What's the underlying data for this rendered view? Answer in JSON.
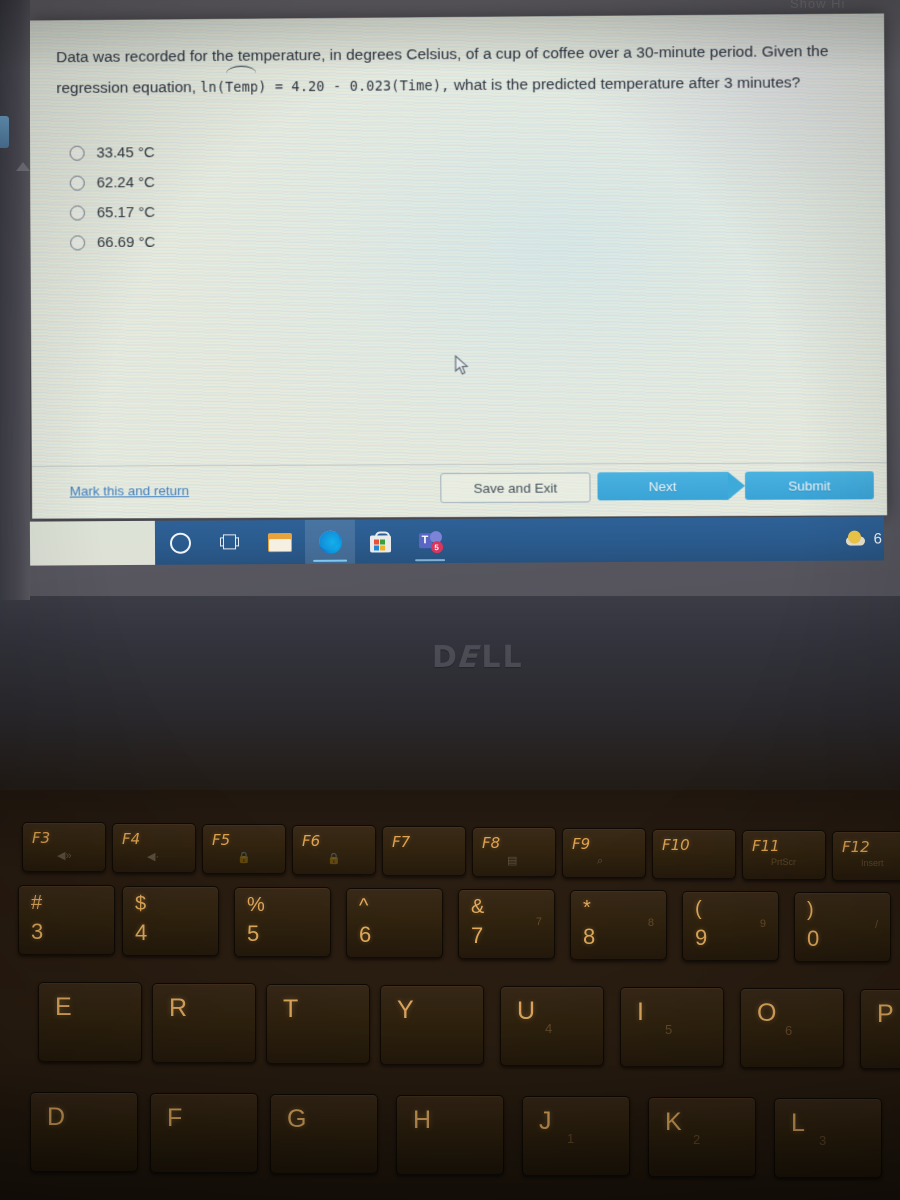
{
  "question": {
    "line1": "Data was recorded for the temperature, in degrees Celsius, of a cup of coffee over a 30-minute period. Given the",
    "line2_prefix": "regression equation, ",
    "equation_ln": "ln(",
    "equation_var": "Temp",
    "equation_rest": ") = 4.20 - 0.023(Time),",
    "line2_suffix": " what is the predicted temperature after 3 minutes?",
    "options": [
      {
        "value": "33.45",
        "unit": "°C",
        "label": "33.45 °C",
        "selected": false
      },
      {
        "value": "62.24",
        "unit": "°C",
        "label": "62.24 °C",
        "selected": false
      },
      {
        "value": "65.17",
        "unit": "°C",
        "label": "65.17 °C",
        "selected": false
      },
      {
        "value": "66.69",
        "unit": "°C",
        "label": "66.69 °C",
        "selected": false
      }
    ]
  },
  "actions": {
    "mark_link": "Mark this and return",
    "save_and_exit": "Save and Exit",
    "next": "Next",
    "submit": "Submit",
    "accent_blue": "#3aa3d6",
    "link_blue": "#3f7fbf"
  },
  "taskbar": {
    "items": [
      {
        "name": "cortana",
        "label": ""
      },
      {
        "name": "task-view",
        "label": ""
      },
      {
        "name": "file-explorer",
        "label": ""
      },
      {
        "name": "microsoft-edge",
        "label": "",
        "active": true
      },
      {
        "name": "microsoft-store",
        "label": ""
      },
      {
        "name": "microsoft-teams",
        "label": "",
        "badge": "5"
      }
    ],
    "weather_temp": "6",
    "background": "#2b5c90"
  },
  "laptop": {
    "brand": "DELL",
    "top_ghost_text": "Show Hi"
  },
  "keyboard": {
    "function_row": [
      {
        "label": "F3",
        "glyph": " "
      },
      {
        "label": "F4",
        "glyph": " "
      },
      {
        "label": "F5",
        "glyph": " "
      },
      {
        "label": "F6",
        "glyph": " "
      },
      {
        "label": "F7",
        "glyph": ""
      },
      {
        "label": "F8",
        "glyph": " "
      },
      {
        "label": "F9",
        "glyph": " "
      },
      {
        "label": "F10",
        "glyph": ""
      },
      {
        "label": "F11",
        "glyph": "",
        "sub": "PrtScr"
      },
      {
        "label": "F12",
        "glyph": "",
        "sub": "Insert"
      }
    ],
    "number_row": [
      {
        "shift": "#",
        "base": "3",
        "alt": ""
      },
      {
        "shift": "$",
        "base": "4",
        "alt": ""
      },
      {
        "shift": "%",
        "base": "5",
        "alt": ""
      },
      {
        "shift": "^",
        "base": "6",
        "alt": ""
      },
      {
        "shift": "&",
        "base": "7",
        "alt": "7"
      },
      {
        "shift": "*",
        "base": "8",
        "alt": "8"
      },
      {
        "shift": "(",
        "base": "9",
        "alt": "9"
      },
      {
        "shift": ")",
        "base": "0",
        "alt": "/"
      }
    ],
    "letter_row_top": [
      {
        "letter": "E",
        "alt": ""
      },
      {
        "letter": "R",
        "alt": ""
      },
      {
        "letter": "T",
        "alt": ""
      },
      {
        "letter": "Y",
        "alt": ""
      },
      {
        "letter": "U",
        "alt": "4"
      },
      {
        "letter": "I",
        "alt": "5"
      },
      {
        "letter": "O",
        "alt": "6"
      },
      {
        "letter": "P",
        "alt": ""
      }
    ],
    "letter_row_home": [
      {
        "letter": "D",
        "alt": ""
      },
      {
        "letter": "F",
        "alt": ""
      },
      {
        "letter": "G",
        "alt": ""
      },
      {
        "letter": "H",
        "alt": ""
      },
      {
        "letter": "J",
        "alt": "1"
      },
      {
        "letter": "K",
        "alt": "2"
      },
      {
        "letter": "L",
        "alt": "3"
      }
    ]
  }
}
